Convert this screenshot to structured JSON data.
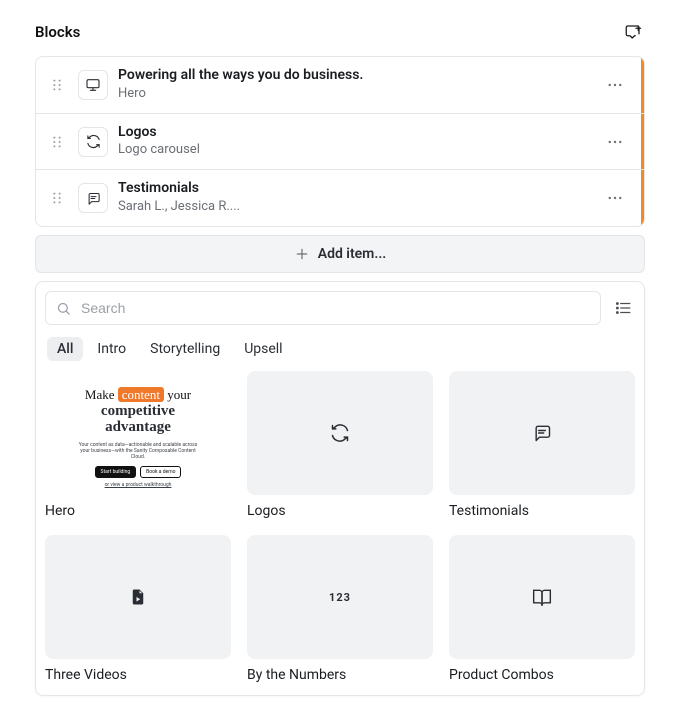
{
  "header": {
    "title": "Blocks"
  },
  "blocks": [
    {
      "title": "Powering all the ways you do business.",
      "subtitle": "Hero",
      "icon": "monitor-icon"
    },
    {
      "title": "Logos",
      "subtitle": "Logo carousel",
      "icon": "refresh-icon"
    },
    {
      "title": "Testimonials",
      "subtitle": "Sarah L., Jessica R....",
      "icon": "chat-icon"
    }
  ],
  "add_bar": {
    "label": "Add item..."
  },
  "search": {
    "placeholder": "Search",
    "value": ""
  },
  "filters": [
    {
      "label": "All",
      "active": true
    },
    {
      "label": "Intro",
      "active": false
    },
    {
      "label": "Storytelling",
      "active": false
    },
    {
      "label": "Upsell",
      "active": false
    }
  ],
  "library": [
    {
      "label": "Hero",
      "thumb": "hero-mock"
    },
    {
      "label": "Logos",
      "thumb": "refresh-icon"
    },
    {
      "label": "Testimonials",
      "thumb": "chat-icon"
    },
    {
      "label": "Three Videos",
      "thumb": "file-icon"
    },
    {
      "label": "By the Numbers",
      "thumb": "numbers"
    },
    {
      "label": "Product Combos",
      "thumb": "book-icon"
    }
  ],
  "hero_mock": {
    "line1_pre": "Make ",
    "line1_pill": "content",
    "line1_post": " your",
    "line2": "competitive",
    "line3": "advantage",
    "sub": "Your content as data—actionable and scalable across your business—with the Sanity Composable Content Cloud.",
    "cta_primary": "Start building",
    "cta_secondary": "Book a demo",
    "link": "or view a product walkthrough"
  },
  "numbers_glyph": "123"
}
